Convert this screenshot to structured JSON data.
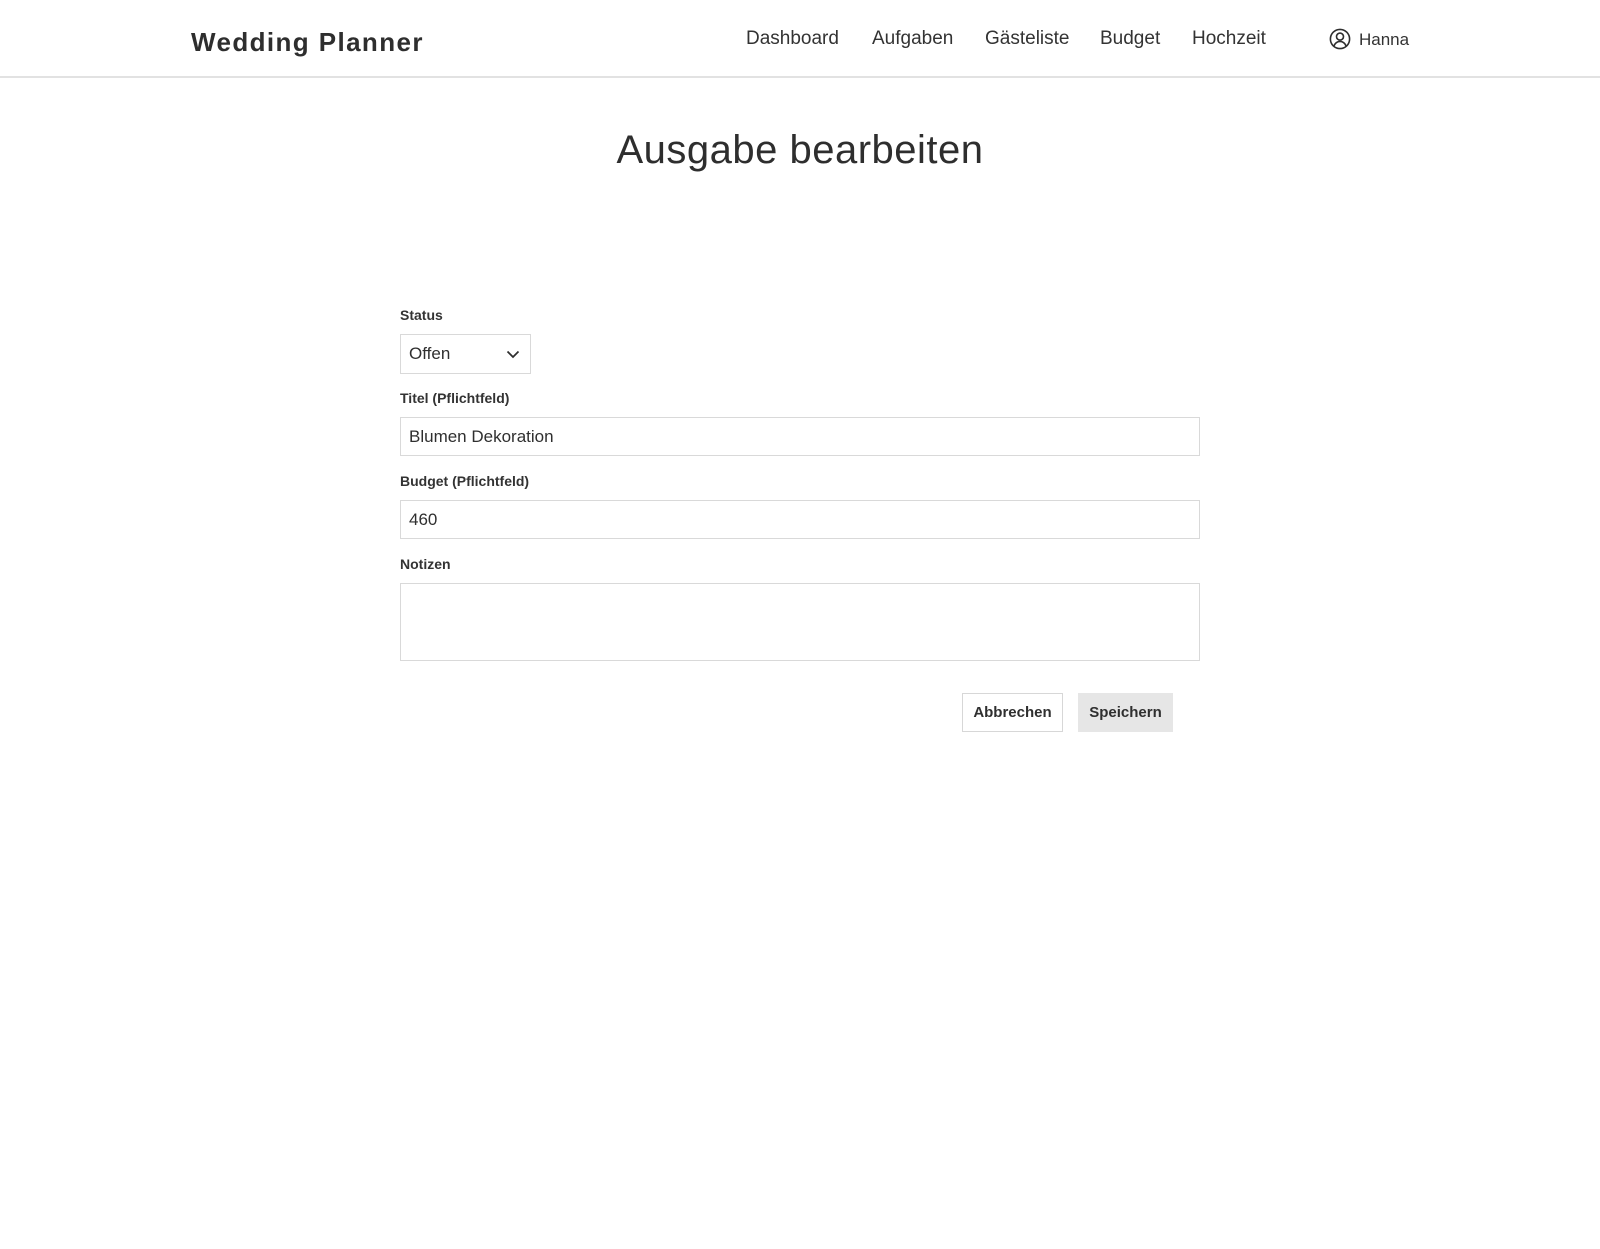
{
  "app": {
    "brand": "Wedding Planner"
  },
  "nav": {
    "items": [
      {
        "label": "Dashboard"
      },
      {
        "label": "Aufgaben"
      },
      {
        "label": "Gästeliste"
      },
      {
        "label": "Budget"
      },
      {
        "label": "Hochzeit"
      }
    ],
    "user": {
      "name": "Hanna",
      "icon": "user-circle-icon"
    }
  },
  "page": {
    "title": "Ausgabe bearbeiten"
  },
  "form": {
    "status": {
      "label": "Status",
      "value": "Offen",
      "icon": "chevron-down-icon"
    },
    "title": {
      "label": "Titel (Pflichtfeld)",
      "value": "Blumen Dekoration"
    },
    "budget": {
      "label": "Budget (Pflichtfeld)",
      "value": "460"
    },
    "notes": {
      "label": "Notizen",
      "value": ""
    }
  },
  "actions": {
    "cancel_label": "Abbrechen",
    "save_label": "Speichern"
  }
}
